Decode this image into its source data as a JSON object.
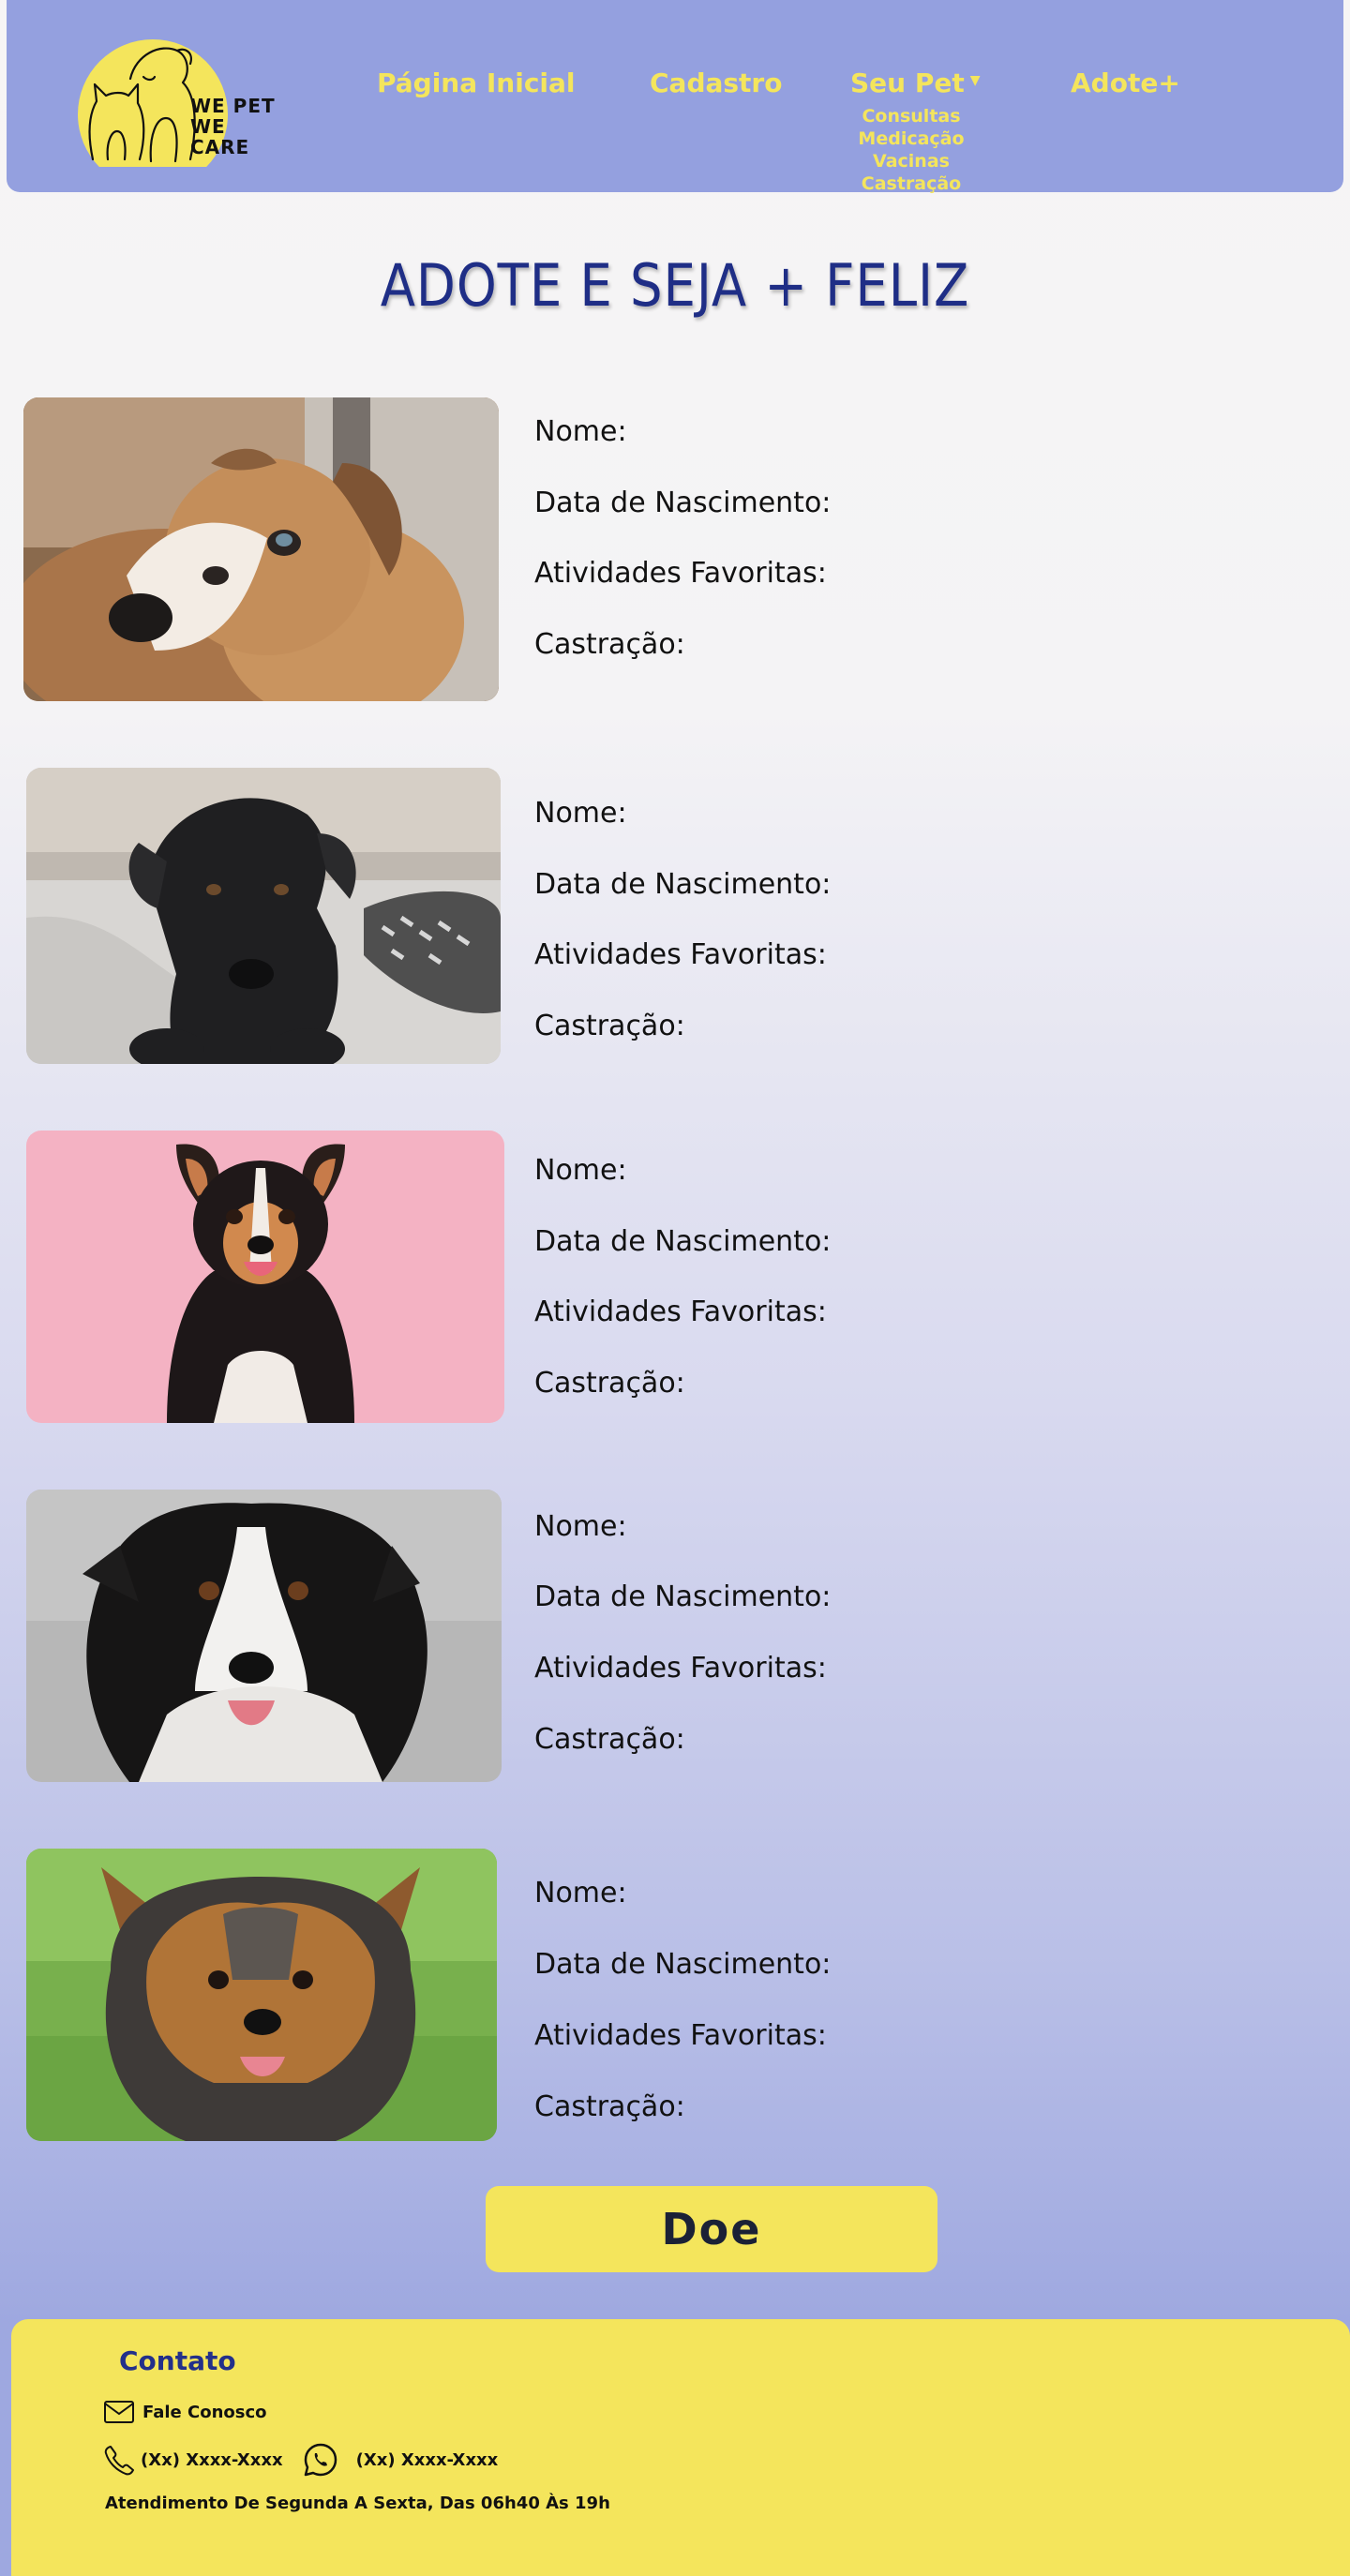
{
  "brand": {
    "logo_line1": "WE PET",
    "logo_line2": "WE CARE",
    "accent": "#f4e55c",
    "header_bg": "#94a0df"
  },
  "nav": {
    "home": "Página Inicial",
    "register": "Cadastro",
    "your_pet": "Seu Pet",
    "adopt": "Adote+",
    "your_pet_submenu": [
      "Consultas",
      "Medicação",
      "Vacinas",
      "Castração"
    ]
  },
  "page_title": "ADOTE E SEJA + FELIZ",
  "dogs": [
    {
      "photo": "brown-white-dog-photo",
      "name_label": "Nome:",
      "birth_label": "Data de Nascimento:",
      "activities_label": "Atividades Favoritas:",
      "castration_label": "Castração:"
    },
    {
      "photo": "black-puppy-photo",
      "name_label": "Nome:",
      "birth_label": "Data de Nascimento:",
      "activities_label": "Atividades Favoritas:",
      "castration_label": "Castração:"
    },
    {
      "photo": "tricolor-dog-pink-background-photo",
      "name_label": "Nome:",
      "birth_label": "Data de Nascimento:",
      "activities_label": "Atividades Favoritas:",
      "castration_label": "Castração:"
    },
    {
      "photo": "border-collie-photo",
      "name_label": "Nome:",
      "birth_label": "Data de Nascimento:",
      "activities_label": "Atividades Favoritas:",
      "castration_label": "Castração:"
    },
    {
      "photo": "yorkshire-terrier-photo",
      "name_label": "Nome:",
      "birth_label": "Data de Nascimento:",
      "activities_label": "Atividades Favoritas:",
      "castration_label": "Castração:"
    }
  ],
  "donate_label": "Doe",
  "footer": {
    "title": "Contato",
    "email_label": "Fale Conosco",
    "phone": "(Xx) Xxxx-Xxxx",
    "whatsapp": "(Xx)  Xxxx-Xxxx",
    "hours": "Atendimento De Segunda A Sexta, Das 06h40 Às 19h"
  }
}
